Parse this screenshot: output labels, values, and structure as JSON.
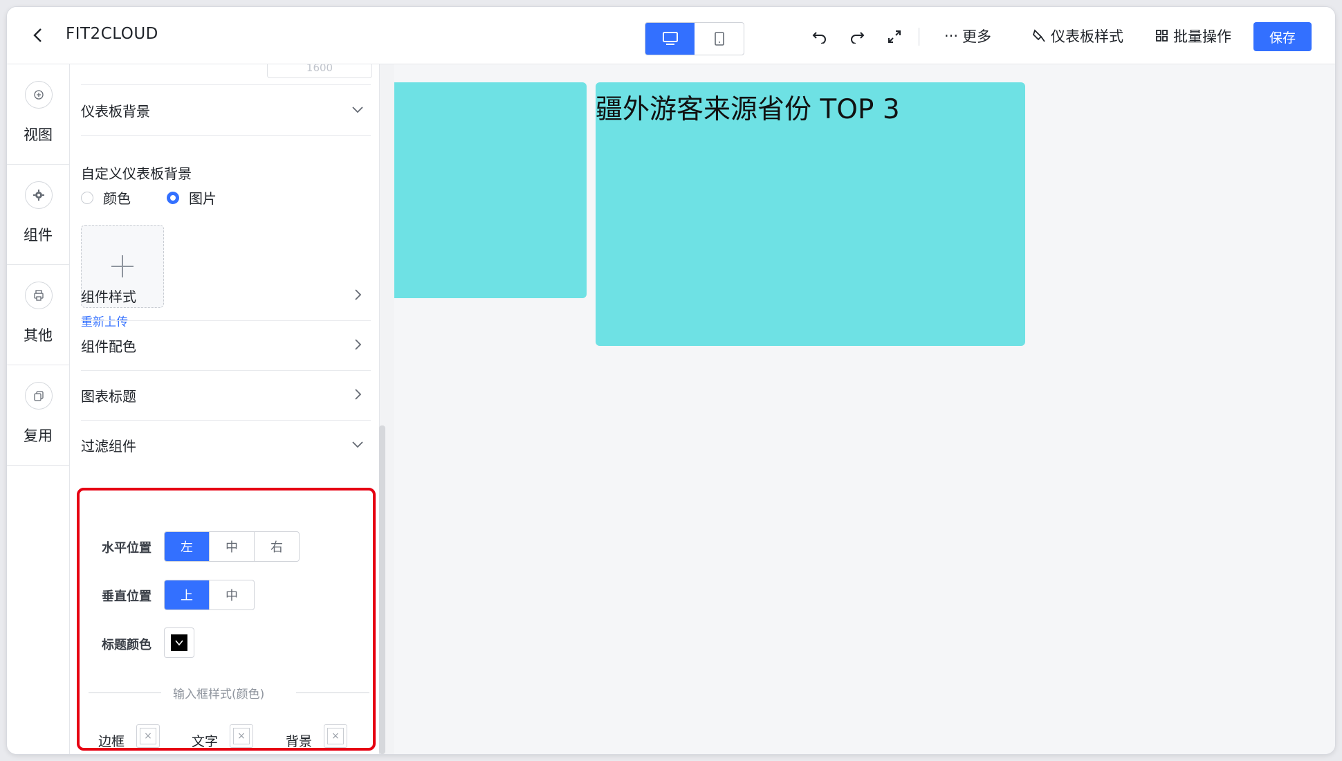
{
  "header": {
    "title": "FIT2CLOUD",
    "more": "更多",
    "dashboard_style": "仪表板样式",
    "batch": "批量操作",
    "save": "保存"
  },
  "nav": {
    "items": [
      {
        "label": "视图",
        "icon": "plus-circle-icon"
      },
      {
        "label": "组件",
        "icon": "gear-icon"
      },
      {
        "label": "其他",
        "icon": "printer-icon"
      },
      {
        "label": "复用",
        "icon": "copy-icon"
      }
    ]
  },
  "panel": {
    "stub_value": "1600",
    "dashboard_bg": "仪表板背景",
    "custom_bg": "自定义仪表板背景",
    "radio_color": "颜色",
    "radio_image": "图片",
    "reupload": "重新上传",
    "component_style": "组件样式",
    "component_color": "组件配色",
    "chart_title": "图表标题",
    "filter": {
      "title": "过滤组件",
      "h_pos_label": "水平位置",
      "h_options": [
        "左",
        "中",
        "右"
      ],
      "v_pos_label": "垂直位置",
      "v_options": [
        "上",
        "中"
      ],
      "title_color_label": "标题颜色",
      "input_style_divider": "输入框样式(颜色)",
      "border": "边框",
      "text": "文字",
      "background": "背景"
    }
  },
  "canvas": {
    "card2_title": "疆外游客来源省份 TOP 3"
  },
  "colors": {
    "accent": "#3370ff",
    "card": "#6ee1e4",
    "highlight": "#e60012"
  }
}
